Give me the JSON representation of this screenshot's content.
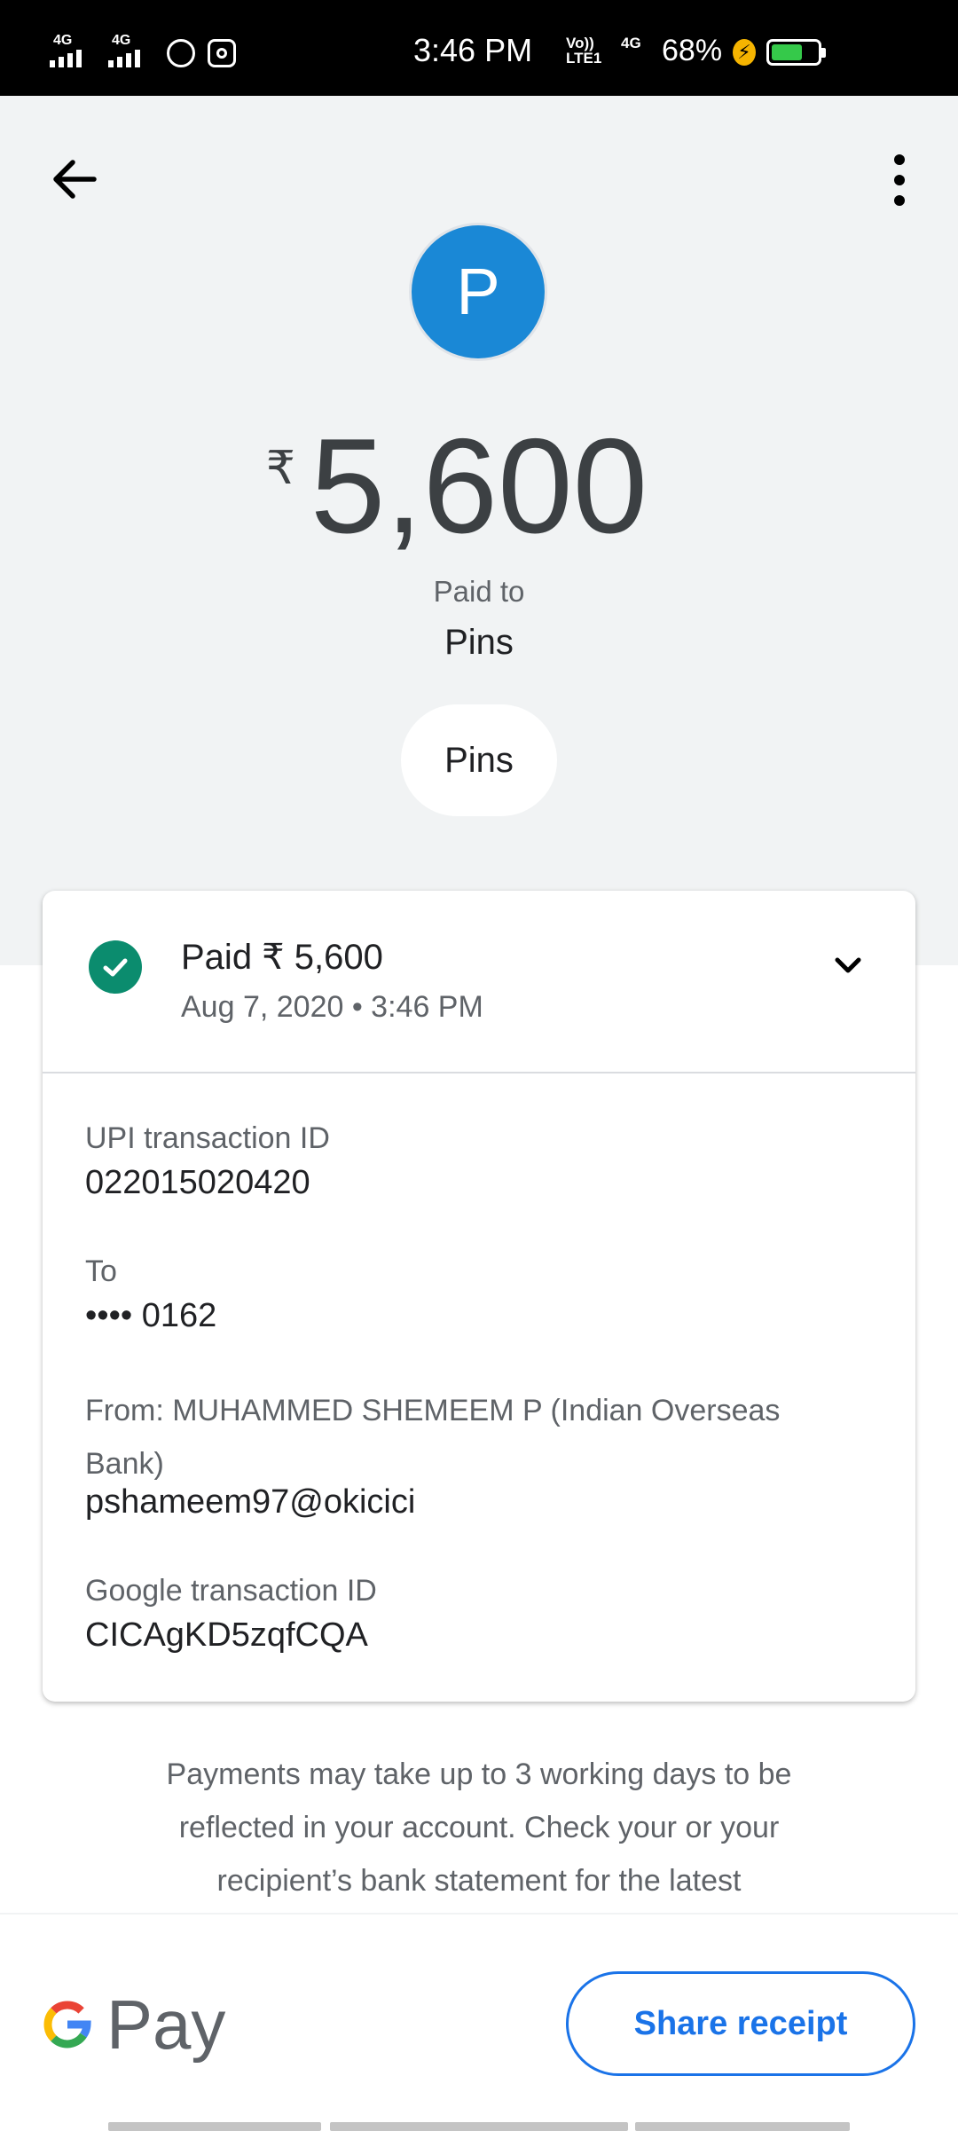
{
  "status_bar": {
    "signal1": "4G",
    "signal2": "4G",
    "time": "3:46 PM",
    "volte": "Vo)) LTE1",
    "net": "4G",
    "battery_pct": "68%",
    "battery_level": 0.68,
    "icons": [
      "whatsapp-icon",
      "instagram-icon",
      "charging-icon",
      "battery-icon"
    ]
  },
  "header": {
    "avatar_letter": "P",
    "currency": "₹",
    "amount": "5,600",
    "paid_to_label": "Paid to",
    "payee_name": "Pins",
    "chip_label": "Pins",
    "avatar_color": "#1a88d6"
  },
  "details": {
    "status_title": "Paid ₹ 5,600",
    "status_date": "Aug 7, 2020 • 3:46 PM",
    "status_color": "#0b8c6e",
    "upi_label": "UPI transaction ID",
    "upi_value": "022015020420",
    "to_label": "To",
    "to_value": "•••• 0162",
    "from_label": "From: MUHAMMED SHEMEEM P (Indian Overseas Bank)",
    "from_value": "pshameem97@okicici",
    "google_label": "Google transaction ID",
    "google_value": "CICAgKD5zqfCQA"
  },
  "note": "Payments may take up to 3 working days to be reflected in your account. Check your or your recipient’s bank statement for the latest",
  "footer": {
    "brand_pay": "Pay",
    "share_label": "Share receipt",
    "accent": "#1a73e8"
  }
}
